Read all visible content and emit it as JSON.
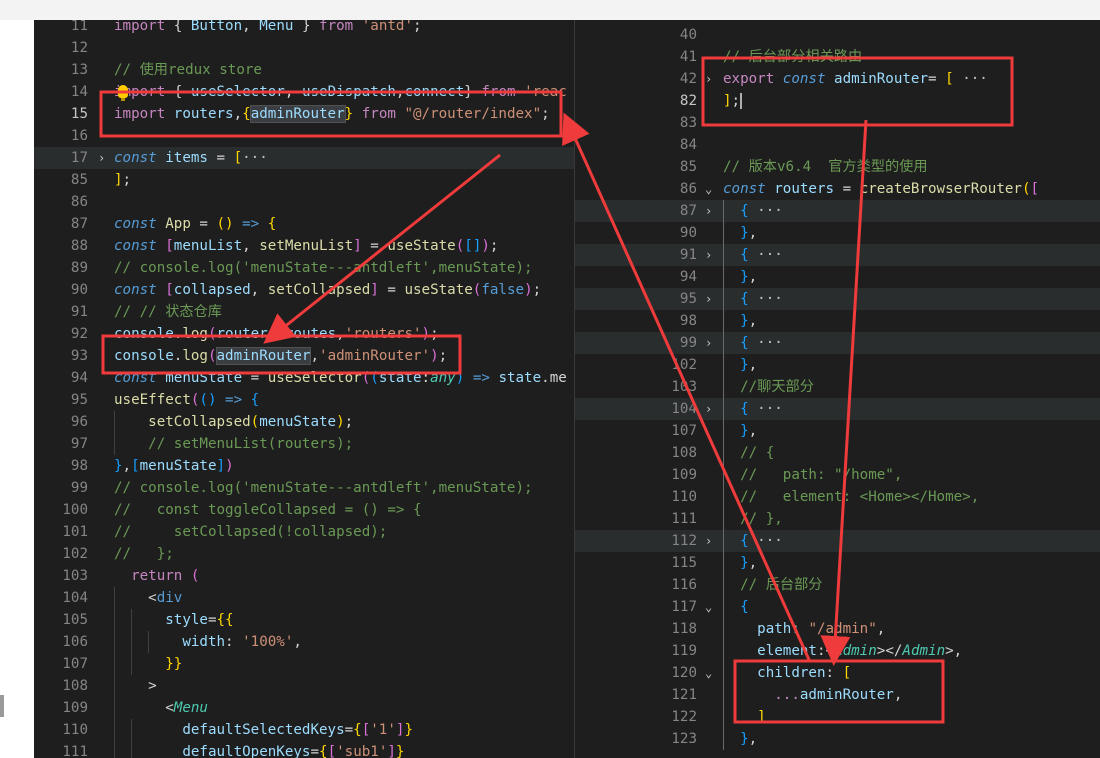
{
  "left_editor": {
    "lines": [
      {
        "n": "11",
        "tokens": [
          [
            "import ",
            "t-kw2"
          ],
          [
            "{ ",
            "t-pl"
          ],
          [
            "Button",
            "t-var"
          ],
          [
            ", ",
            "t-pl"
          ],
          [
            "Menu",
            "t-var"
          ],
          [
            " } ",
            "t-pl"
          ],
          [
            "from ",
            "t-kw2"
          ],
          [
            "'antd'",
            "t-str"
          ],
          [
            ";",
            "t-pl"
          ]
        ]
      },
      {
        "n": "12",
        "tokens": []
      },
      {
        "n": "13",
        "tokens": [
          [
            "// 使用redux store",
            "t-cmt"
          ]
        ]
      },
      {
        "n": "14",
        "tokens": [
          [
            "import ",
            "t-kw2"
          ],
          [
            "{ ",
            "t-pl"
          ],
          [
            "useSelector",
            "t-var"
          ],
          [
            ", ",
            "t-pl"
          ],
          [
            "useDispatch",
            "t-var"
          ],
          [
            ",",
            "t-pl"
          ],
          [
            "connect",
            "t-var"
          ],
          [
            "} ",
            "t-pl"
          ],
          [
            "from ",
            "t-kw2"
          ],
          [
            "'reac",
            "t-str"
          ]
        ]
      },
      {
        "n": "15",
        "tokens": [
          [
            "import ",
            "t-kw2"
          ],
          [
            "routers",
            "t-var"
          ],
          [
            ",",
            "t-pl"
          ],
          [
            "{",
            "t-br1"
          ],
          [
            "adminRouter",
            "t-var t-word"
          ],
          [
            "}",
            "t-br1"
          ],
          [
            " from ",
            "t-kw2"
          ],
          [
            "\"@/router/index\"",
            "t-str"
          ],
          [
            ";",
            "t-pl"
          ]
        ]
      },
      {
        "n": "16",
        "tokens": []
      },
      {
        "n": "17",
        "tokens": [
          [
            "const ",
            "t-kwi"
          ],
          [
            "items ",
            "t-var"
          ],
          [
            "= ",
            "t-pl"
          ],
          [
            "[",
            "t-br1"
          ],
          [
            "···",
            "t-dim"
          ]
        ]
      },
      {
        "n": "85",
        "tokens": [
          [
            "]",
            "t-br1"
          ],
          [
            ";",
            "t-pl"
          ]
        ]
      },
      {
        "n": "86",
        "tokens": []
      },
      {
        "n": "87",
        "tokens": [
          [
            "const ",
            "t-kwi"
          ],
          [
            "App ",
            "t-fn"
          ],
          [
            "= ",
            "t-pl"
          ],
          [
            "() ",
            "t-br1"
          ],
          [
            "=> ",
            "t-kw"
          ],
          [
            "{",
            "t-br1"
          ]
        ]
      },
      {
        "n": "88",
        "tokens": [
          [
            "const ",
            "t-kwi"
          ],
          [
            "[",
            "t-br2"
          ],
          [
            "menuList",
            "t-var"
          ],
          [
            ", ",
            "t-pl"
          ],
          [
            "setMenuList",
            "t-fn"
          ],
          [
            "] ",
            "t-br2"
          ],
          [
            "= ",
            "t-pl"
          ],
          [
            "useState",
            "t-fn"
          ],
          [
            "(",
            "t-br2"
          ],
          [
            "[]",
            "t-br3"
          ],
          [
            ")",
            "t-br2"
          ],
          [
            ";",
            "t-pl"
          ]
        ]
      },
      {
        "n": "89",
        "tokens": [
          [
            "// console.log('menuState---antdleft',menuState);",
            "t-cmt"
          ]
        ]
      },
      {
        "n": "90",
        "tokens": [
          [
            "const ",
            "t-kwi"
          ],
          [
            "[",
            "t-br2"
          ],
          [
            "collapsed",
            "t-var"
          ],
          [
            ", ",
            "t-pl"
          ],
          [
            "setCollapsed",
            "t-fn"
          ],
          [
            "] ",
            "t-br2"
          ],
          [
            "= ",
            "t-pl"
          ],
          [
            "useState",
            "t-fn"
          ],
          [
            "(",
            "t-br2"
          ],
          [
            "false",
            "t-kw"
          ],
          [
            ")",
            "t-br2"
          ],
          [
            ";",
            "t-pl"
          ]
        ]
      },
      {
        "n": "91",
        "tokens": [
          [
            "// // 状态仓库",
            "t-cmt"
          ]
        ]
      },
      {
        "n": "92",
        "tokens": [
          [
            "console",
            "t-var"
          ],
          [
            ".",
            "t-pl"
          ],
          [
            "log",
            "t-fn"
          ],
          [
            "(",
            "t-br2"
          ],
          [
            "routers",
            "t-var"
          ],
          [
            ".",
            "t-pl"
          ],
          [
            "routes",
            "t-var"
          ],
          [
            ",",
            "t-pl"
          ],
          [
            "'routers'",
            "t-str"
          ],
          [
            ")",
            "t-br2"
          ],
          [
            ";",
            "t-pl"
          ]
        ]
      },
      {
        "n": "93",
        "tokens": [
          [
            "console",
            "t-var"
          ],
          [
            ".",
            "t-pl"
          ],
          [
            "log",
            "t-fn"
          ],
          [
            "(",
            "t-br2"
          ],
          [
            "adminRouter",
            "t-var t-word"
          ],
          [
            ",",
            "t-pl"
          ],
          [
            "'adminRouter'",
            "t-str"
          ],
          [
            ")",
            "t-br2"
          ],
          [
            ";",
            "t-pl"
          ]
        ]
      },
      {
        "n": "94",
        "tokens": [
          [
            "const ",
            "t-kwi"
          ],
          [
            "menuState ",
            "t-var"
          ],
          [
            "= ",
            "t-pl"
          ],
          [
            "useSelector",
            "t-fn"
          ],
          [
            "(",
            "t-br2"
          ],
          [
            "(",
            "t-br3"
          ],
          [
            "state",
            "t-var"
          ],
          [
            ":",
            "t-pl"
          ],
          [
            "any",
            "t-cls"
          ],
          [
            ") ",
            "t-br3"
          ],
          [
            "=> ",
            "t-kw"
          ],
          [
            "state",
            "t-var"
          ],
          [
            ".me",
            "t-pl"
          ]
        ]
      },
      {
        "n": "95",
        "tokens": [
          [
            "useEffect",
            "t-fn"
          ],
          [
            "(",
            "t-br2"
          ],
          [
            "() ",
            "t-br3"
          ],
          [
            "=> ",
            "t-kw"
          ],
          [
            "{",
            "t-br3"
          ]
        ]
      },
      {
        "n": "96",
        "tokens": [
          [
            "    setCollapsed",
            "t-fn"
          ],
          [
            "(",
            "t-br1"
          ],
          [
            "menuState",
            "t-var"
          ],
          [
            ")",
            "t-br1"
          ],
          [
            ";",
            "t-pl"
          ]
        ]
      },
      {
        "n": "97",
        "tokens": [
          [
            "    // setMenuList(routers);",
            "t-cmt"
          ]
        ]
      },
      {
        "n": "98",
        "tokens": [
          [
            "}",
            "t-br3"
          ],
          [
            ",",
            "t-pl"
          ],
          [
            "[",
            "t-br3"
          ],
          [
            "menuState",
            "t-var"
          ],
          [
            "]",
            "t-br3"
          ],
          [
            ")",
            "t-br2"
          ]
        ]
      },
      {
        "n": "99",
        "tokens": [
          [
            "// console.log('menuState---antdleft',menuState);",
            "t-cmt"
          ]
        ]
      },
      {
        "n": "100",
        "tokens": [
          [
            "//   const toggleCollapsed = () => {",
            "t-cmt"
          ]
        ]
      },
      {
        "n": "101",
        "tokens": [
          [
            "//     setCollapsed(!collapsed);",
            "t-cmt"
          ]
        ]
      },
      {
        "n": "102",
        "tokens": [
          [
            "//   };",
            "t-cmt"
          ]
        ]
      },
      {
        "n": "103",
        "tokens": [
          [
            "  return ",
            "t-kw2"
          ],
          [
            "(",
            "t-br2"
          ]
        ]
      },
      {
        "n": "104",
        "tokens": [
          [
            "    <",
            "t-pl"
          ],
          [
            "div",
            "t-kw"
          ]
        ]
      },
      {
        "n": "105",
        "tokens": [
          [
            "      style",
            "t-var"
          ],
          [
            "=",
            "t-pl"
          ],
          [
            "{{",
            "t-br1"
          ]
        ]
      },
      {
        "n": "106",
        "tokens": [
          [
            "        width",
            "t-var"
          ],
          [
            ": ",
            "t-pl"
          ],
          [
            "'100%'",
            "t-str"
          ],
          [
            ",",
            "t-pl"
          ]
        ]
      },
      {
        "n": "107",
        "tokens": [
          [
            "      }}",
            "t-br1"
          ]
        ]
      },
      {
        "n": "108",
        "tokens": [
          [
            "    >",
            "t-pl"
          ]
        ]
      },
      {
        "n": "109",
        "tokens": [
          [
            "      <",
            "t-pl"
          ],
          [
            "Menu",
            "t-cls"
          ]
        ]
      },
      {
        "n": "110",
        "tokens": [
          [
            "        defaultSelectedKeys",
            "t-var"
          ],
          [
            "=",
            "t-pl"
          ],
          [
            "{",
            "t-br1"
          ],
          [
            "[",
            "t-br2"
          ],
          [
            "'1'",
            "t-str"
          ],
          [
            "]",
            "t-br2"
          ],
          [
            "}",
            "t-br1"
          ]
        ]
      },
      {
        "n": "111",
        "tokens": [
          [
            "        defaultOpenKeys",
            "t-var"
          ],
          [
            "=",
            "t-pl"
          ],
          [
            "{",
            "t-br1"
          ],
          [
            "[",
            "t-br2"
          ],
          [
            "'sub1'",
            "t-str"
          ],
          [
            "]",
            "t-br2"
          ],
          [
            "}",
            "t-br1"
          ]
        ]
      }
    ]
  },
  "right_editor": {
    "lines": [
      {
        "n": "40",
        "tokens": []
      },
      {
        "n": "41",
        "tokens": [
          [
            "// 后台部分相关路由",
            "t-cmt"
          ]
        ]
      },
      {
        "n": "42",
        "tokens": [
          [
            "export ",
            "t-kw2"
          ],
          [
            "const ",
            "t-kwi"
          ],
          [
            "adminRouter",
            "t-var"
          ],
          [
            "= ",
            "t-pl"
          ],
          [
            "[",
            "t-br1"
          ],
          [
            " ···",
            "t-dim"
          ]
        ]
      },
      {
        "n": "82",
        "tokens": [
          [
            "]",
            "t-br1"
          ],
          [
            ";",
            "t-pl"
          ]
        ]
      },
      {
        "n": "83",
        "tokens": []
      },
      {
        "n": "84",
        "tokens": []
      },
      {
        "n": "85",
        "tokens": [
          [
            "// 版本v6.4  官方类型的使用",
            "t-cmt"
          ]
        ]
      },
      {
        "n": "86",
        "tokens": [
          [
            "const ",
            "t-kwi"
          ],
          [
            "routers ",
            "t-var"
          ],
          [
            "= ",
            "t-pl"
          ],
          [
            "createBrowserRouter",
            "t-fn"
          ],
          [
            "(",
            "t-br1"
          ],
          [
            "[",
            "t-br2"
          ]
        ]
      },
      {
        "n": "87",
        "tokens": [
          [
            "  {",
            "t-br3"
          ],
          [
            " ···",
            "t-dim"
          ]
        ]
      },
      {
        "n": "90",
        "tokens": [
          [
            "  }",
            "t-br3"
          ],
          [
            ",",
            "t-pl"
          ]
        ]
      },
      {
        "n": "91",
        "tokens": [
          [
            "  {",
            "t-br3"
          ],
          [
            " ···",
            "t-dim"
          ]
        ]
      },
      {
        "n": "94",
        "tokens": [
          [
            "  }",
            "t-br3"
          ],
          [
            ",",
            "t-pl"
          ]
        ]
      },
      {
        "n": "95",
        "tokens": [
          [
            "  {",
            "t-br3"
          ],
          [
            " ···",
            "t-dim"
          ]
        ]
      },
      {
        "n": "98",
        "tokens": [
          [
            "  }",
            "t-br3"
          ],
          [
            ",",
            "t-pl"
          ]
        ]
      },
      {
        "n": "99",
        "tokens": [
          [
            "  {",
            "t-br3"
          ],
          [
            " ···",
            "t-dim"
          ]
        ]
      },
      {
        "n": "102",
        "tokens": [
          [
            "  }",
            "t-br3"
          ],
          [
            ",",
            "t-pl"
          ]
        ]
      },
      {
        "n": "103",
        "tokens": [
          [
            "  //聊天部分",
            "t-cmt"
          ]
        ]
      },
      {
        "n": "104",
        "tokens": [
          [
            "  {",
            "t-br3"
          ],
          [
            " ···",
            "t-dim"
          ]
        ]
      },
      {
        "n": "107",
        "tokens": [
          [
            "  }",
            "t-br3"
          ],
          [
            ",",
            "t-pl"
          ]
        ]
      },
      {
        "n": "108",
        "tokens": [
          [
            "  // {",
            "t-cmt"
          ]
        ]
      },
      {
        "n": "109",
        "tokens": [
          [
            "  //   path: \"/home\",",
            "t-cmt"
          ]
        ]
      },
      {
        "n": "110",
        "tokens": [
          [
            "  //   element: <Home></Home>,",
            "t-cmt"
          ]
        ]
      },
      {
        "n": "111",
        "tokens": [
          [
            "  // },",
            "t-cmt"
          ]
        ]
      },
      {
        "n": "112",
        "tokens": [
          [
            "  {",
            "t-br3"
          ],
          [
            " ···",
            "t-dim"
          ]
        ]
      },
      {
        "n": "115",
        "tokens": [
          [
            "  }",
            "t-br3"
          ],
          [
            ",",
            "t-pl"
          ]
        ]
      },
      {
        "n": "116",
        "tokens": [
          [
            "  // 后台部分",
            "t-cmt"
          ]
        ]
      },
      {
        "n": "117",
        "tokens": [
          [
            "  {",
            "t-br3"
          ]
        ]
      },
      {
        "n": "118",
        "tokens": [
          [
            "    path",
            "t-var"
          ],
          [
            ": ",
            "t-pl"
          ],
          [
            "\"/admin\"",
            "t-str"
          ],
          [
            ",",
            "t-pl"
          ]
        ]
      },
      {
        "n": "119",
        "tokens": [
          [
            "    element",
            "t-var"
          ],
          [
            ":",
            "t-pl"
          ],
          [
            "<",
            "t-pl"
          ],
          [
            "Admin",
            "t-cls"
          ],
          [
            "></",
            "t-pl"
          ],
          [
            "Admin",
            "t-cls"
          ],
          [
            ">",
            "t-pl"
          ],
          [
            ",",
            "t-pl"
          ]
        ]
      },
      {
        "n": "120",
        "tokens": [
          [
            "    children",
            "t-var"
          ],
          [
            ": ",
            "t-pl"
          ],
          [
            "[",
            "t-br1"
          ]
        ]
      },
      {
        "n": "121",
        "tokens": [
          [
            "      ...",
            "t-kw2"
          ],
          [
            "adminRouter",
            "t-var"
          ],
          [
            ",",
            "t-pl"
          ]
        ]
      },
      {
        "n": "122",
        "tokens": [
          [
            "    ]",
            "t-br1"
          ]
        ]
      },
      {
        "n": "123",
        "tokens": [
          [
            "  }",
            "t-br3"
          ],
          [
            ",",
            "t-pl"
          ]
        ]
      }
    ]
  },
  "annotations": {
    "box_color": "#ef3b3b",
    "arrow_color": "#ef3b3b"
  }
}
